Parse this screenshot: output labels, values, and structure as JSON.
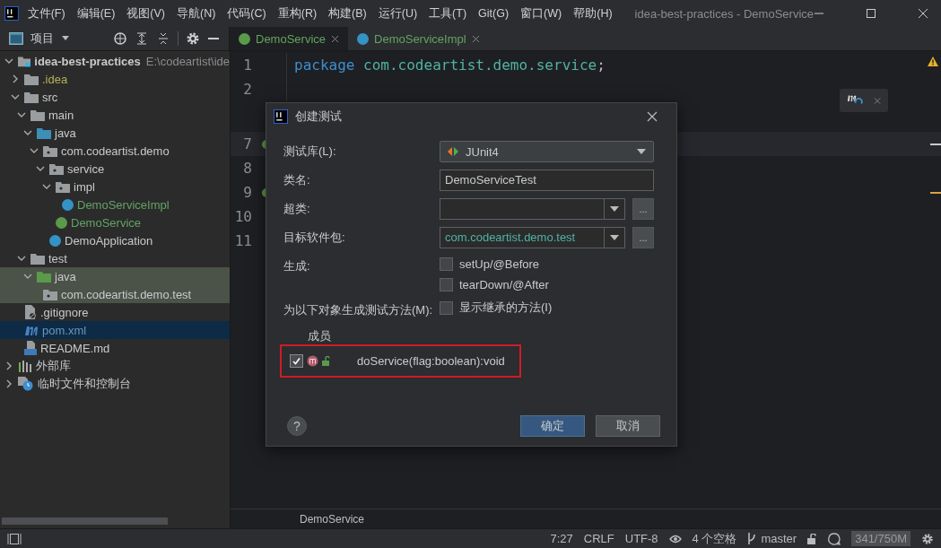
{
  "window": {
    "title": "idea-best-practices - DemoService"
  },
  "menu": [
    "文件(F)",
    "编辑(E)",
    "视图(V)",
    "导航(N)",
    "代码(C)",
    "重构(R)",
    "构建(B)",
    "运行(U)",
    "工具(T)",
    "Git(G)",
    "窗口(W)",
    "帮助(H)"
  ],
  "project_panel": {
    "title": "项目"
  },
  "editor_tabs": [
    {
      "label": "DemoService",
      "kind": "interface",
      "selected": true
    },
    {
      "label": "DemoServiceImpl",
      "kind": "class",
      "selected": false
    }
  ],
  "tree": [
    {
      "label": "idea-best-practices",
      "path": "E:\\codeartist\\ide",
      "kind": "project",
      "expanded": true,
      "selected": false,
      "highlighted": false,
      "children": [
        {
          "label": ".idea",
          "kind": "folder",
          "color": "#b5b05a",
          "expanded": false,
          "selected": false,
          "highlighted": false
        },
        {
          "label": "src",
          "kind": "folder",
          "expanded": true,
          "selected": false,
          "highlighted": false,
          "children": [
            {
              "label": "main",
              "kind": "folder",
              "expanded": true,
              "selected": false,
              "highlighted": false,
              "children": [
                {
                  "label": "java",
                  "kind": "source",
                  "expanded": true,
                  "selected": false,
                  "highlighted": false,
                  "children": [
                    {
                      "label": "com.codeartist.demo",
                      "kind": "package",
                      "expanded": true,
                      "selected": false,
                      "highlighted": false,
                      "children": [
                        {
                          "label": "service",
                          "kind": "package",
                          "expanded": true,
                          "selected": false,
                          "highlighted": false,
                          "children": [
                            {
                              "label": "impl",
                              "kind": "package",
                              "expanded": true,
                              "selected": false,
                              "highlighted": false,
                              "children": [
                                {
                                  "label": "DemoServiceImpl",
                                  "kind": "class",
                                  "color": "#62a362",
                                  "selected": false,
                                  "highlighted": false
                                }
                              ]
                            },
                            {
                              "label": "DemoService",
                              "kind": "interface",
                              "color": "#62a362",
                              "selected": false,
                              "highlighted": false
                            }
                          ]
                        },
                        {
                          "label": "DemoApplication",
                          "kind": "application",
                          "selected": false,
                          "highlighted": false
                        }
                      ]
                    }
                  ]
                }
              ]
            },
            {
              "label": "test",
              "kind": "folder",
              "expanded": true,
              "selected": false,
              "highlighted": false,
              "children": [
                {
                  "label": "java",
                  "kind": "tests",
                  "expanded": true,
                  "selected": false,
                  "highlighted": true,
                  "children": [
                    {
                      "label": "com.codeartist.demo.test",
                      "kind": "package",
                      "selected": false,
                      "highlighted": true
                    }
                  ]
                }
              ]
            }
          ]
        },
        {
          "label": ".gitignore",
          "kind": "ignore",
          "selected": false,
          "highlighted": false
        },
        {
          "label": "pom.xml",
          "kind": "maven",
          "color": "#6897bb",
          "selected": true,
          "highlighted": false
        },
        {
          "label": "README.md",
          "kind": "markdown",
          "selected": false,
          "highlighted": false
        }
      ]
    },
    {
      "label": "外部库",
      "kind": "library",
      "expanded": false,
      "selected": false,
      "highlighted": false
    },
    {
      "label": "临时文件和控制台",
      "kind": "scratch",
      "expanded": false,
      "selected": false,
      "highlighted": false
    }
  ],
  "editor": {
    "lines": [
      {
        "number": "1",
        "current": false,
        "marker": false,
        "gap_before": false,
        "tokens": [
          {
            "kind": "keyword",
            "text": "package"
          },
          {
            "kind": "name",
            "text": " com.codeartist.demo.service"
          },
          {
            "kind": "plain",
            "text": ";"
          }
        ]
      },
      {
        "number": "2",
        "current": false,
        "marker": false,
        "gap_before": false
      },
      {
        "number": "7",
        "current": true,
        "marker": true,
        "gap_before": true,
        "color": "#c8cacc"
      },
      {
        "number": "8",
        "current": false,
        "marker": false,
        "gap_before": false
      },
      {
        "number": "9",
        "current": false,
        "marker": true,
        "gap_before": false,
        "color": "#d9a343"
      },
      {
        "number": "10",
        "current": false,
        "marker": false,
        "gap_before": false
      },
      {
        "number": "11",
        "current": false,
        "marker": false,
        "gap_before": false
      }
    ],
    "breadcrumb": "DemoService"
  },
  "dialog": {
    "title": "创建测试",
    "rows": [
      {
        "kind": "dropdown",
        "label": "测试库(L):",
        "value": "JUnit4"
      },
      {
        "kind": "text",
        "label": "类名:",
        "value": "DemoServiceTest"
      },
      {
        "kind": "combo",
        "label": "超类:",
        "button": "..."
      },
      {
        "kind": "combo",
        "label": "目标软件包:",
        "value": "com.codeartist.demo.test",
        "button": "..."
      },
      {
        "kind": "checkboxes",
        "label": "生成:",
        "options": [
          {
            "label": "setUp/@Before",
            "checked": false
          },
          {
            "label": "tearDown/@After",
            "checked": false
          }
        ]
      },
      {
        "kind": "checkboxes",
        "label": "为以下对象生成测试方法(M):",
        "options": [
          {
            "label": "显示继承的方法(I)",
            "checked": false
          }
        ]
      }
    ],
    "members": {
      "header": "成员",
      "rows": [
        {
          "signature": "doService(flag:boolean):void",
          "checked": true,
          "highlighted": true
        }
      ]
    },
    "help": "?",
    "buttons": [
      {
        "label": "确定",
        "primary": true
      },
      {
        "label": "取消",
        "primary": false
      }
    ]
  },
  "status_bar": {
    "position": "7:27",
    "line_separator": "CRLF",
    "encoding": "UTF-8",
    "indent": "4 个空格",
    "branch": "master",
    "memory": "341/750M"
  }
}
